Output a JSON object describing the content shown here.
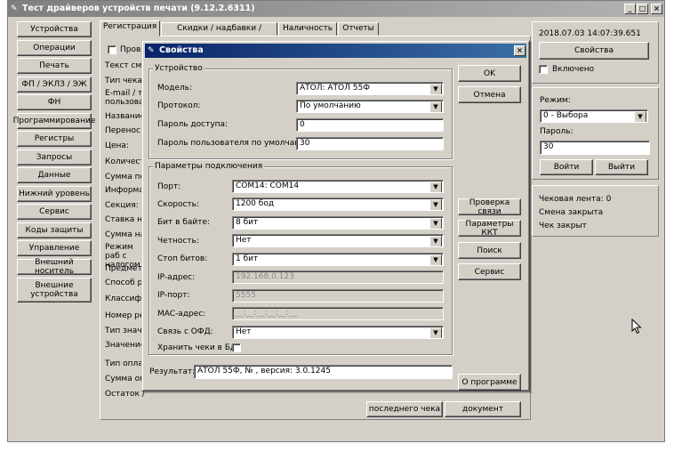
{
  "window": {
    "title": "Тест драйверов устройств печати (9.12.2.6311)",
    "controls": [
      "_",
      "□",
      "×"
    ]
  },
  "sidebar": {
    "items": [
      "Устройства",
      "Операции",
      "Печать",
      "ФП / ЭКЛЗ / ЭЖ",
      "ФН",
      "Программирование",
      "Регистры",
      "Запросы",
      "Данные",
      "Нижний уровень",
      "Сервис",
      "Коды защиты",
      "Управление",
      "Внешний носитель",
      "Внешние устройства"
    ]
  },
  "tabs": [
    "Регистрация",
    "Скидки / надбавки / налоги",
    "Наличность",
    "Отчеты"
  ],
  "registration": {
    "checkbox_label": "Прове",
    "labels": [
      "Текст сме",
      "Тип чека:",
      "E-mail / т пользоват",
      "Название",
      "Перенос т",
      "Цена:",
      "Количест",
      "Сумма поз",
      "Информа",
      "Секция:",
      "Ставка на",
      "Сумма на",
      "Режим раб с налогом",
      "Предмет р",
      "Способ ра",
      "Классифи",
      "Номер рек",
      "Тип значе",
      "Значение",
      "Тип оплат",
      "Сумма опл",
      "Остаток /"
    ],
    "bottom_buttons": [
      "последнего чека",
      "документ"
    ]
  },
  "right_panel": {
    "timestamp": "2018.07.03 14:07:39.651",
    "properties_button": "Свойства",
    "enabled_label": "Включено",
    "mode_label": "Режим:",
    "mode_value": "0 - Выбора",
    "password_label": "Пароль:",
    "password_value": "30",
    "login_button": "Войти",
    "logout_button": "Выйти",
    "status": [
      "Чековая лента: 0",
      "Смена закрыта",
      "Чек закрыт"
    ]
  },
  "dialog": {
    "title": "Свойства",
    "device_group": {
      "title": "Устройство",
      "model_label": "Модель:",
      "model_value": "АТОЛ: АТОЛ 55Ф",
      "protocol_label": "Протокол:",
      "protocol_value": "По умолчанию",
      "access_pw_label": "Пароль доступа:",
      "access_pw_value": "0",
      "user_pw_label": "Пароль пользователя по умолчанию:",
      "user_pw_value": "30"
    },
    "conn_group": {
      "title": "Параметры подключения",
      "port_label": "Порт:",
      "port_value": "COM14: COM14",
      "speed_label": "Скорость:",
      "speed_value": "1200 бод",
      "bits_label": "Бит в байте:",
      "bits_value": "8 бит",
      "parity_label": "Четность:",
      "parity_value": "Нет",
      "stopbits_label": "Стоп битов:",
      "stopbits_value": "1 бит",
      "ip_label": "IP-адрес:",
      "ip_value": "192.168.0.123",
      "ipport_label": "IP-порт:",
      "ipport_value": "5555",
      "mac_label": "MAC-адрес:",
      "mac_value": "__:__:__:__:__:__",
      "ofd_label": "Связь с ОФД:",
      "ofd_value": "Нет",
      "store_label": "Хранить чеки в БД:"
    },
    "result_label": "Результат:",
    "result_value": "АТОЛ 55Ф, №                          , версия: 3.0.1245",
    "buttons": {
      "ok": "OK",
      "cancel": "Отмена",
      "check": "Проверка связи",
      "kkt": "Параметры ККТ",
      "search": "Поиск",
      "service": "Сервис",
      "about": "О программе"
    }
  }
}
